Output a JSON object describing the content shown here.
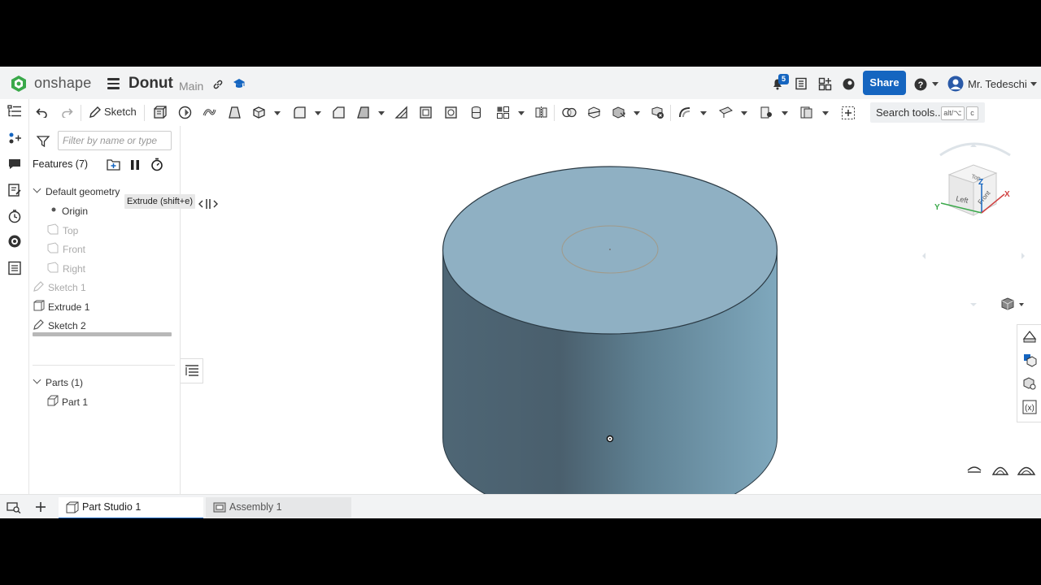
{
  "app": {
    "logo_text": "onshape",
    "document_title": "Donut",
    "branch": "Main",
    "notifications_count": "5",
    "share_label": "Share",
    "user_name": "Mr. Tedeschi"
  },
  "toolbar": {
    "sketch_label": "Sketch",
    "search_label": "Search tools...",
    "search_shortcut_1": "alt/⌥",
    "search_shortcut_2": "c",
    "tooltip": "Extrude (shift+e)"
  },
  "feature_panel": {
    "filter_placeholder": "Filter by name or type",
    "features_heading": "Features (7)",
    "default_geometry": "Default geometry",
    "origin": "Origin",
    "planes": [
      "Top",
      "Front",
      "Right"
    ],
    "features": [
      "Sketch 1",
      "Extrude 1",
      "Sketch 2"
    ],
    "parts_heading": "Parts (1)",
    "parts": [
      "Part 1"
    ]
  },
  "view_cube": {
    "faces": [
      "Top",
      "Left",
      "Front"
    ],
    "axes": [
      "Z",
      "Y",
      "X"
    ]
  },
  "tabs": {
    "items": [
      "Part Studio 1",
      "Assembly 1"
    ],
    "active": "Part Studio 1"
  },
  "colors": {
    "accent": "#1565c0",
    "logo_green": "#3aa94a",
    "part_top": "#8fb0c3",
    "part_side_dark": "#4e6675",
    "part_side_light": "#7aa4ba"
  }
}
